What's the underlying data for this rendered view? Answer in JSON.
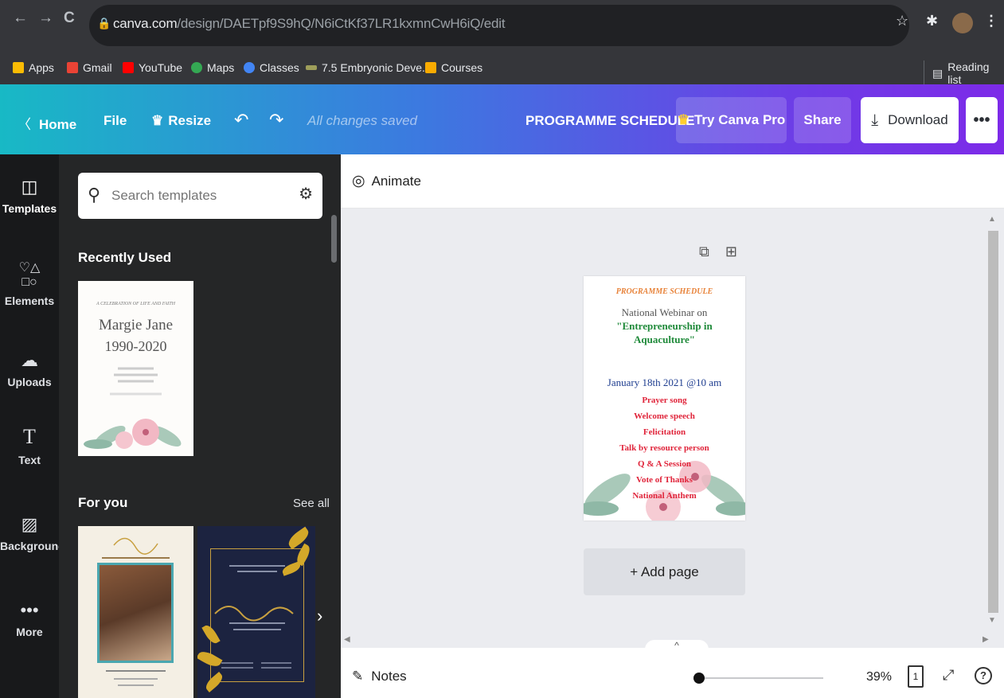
{
  "browser": {
    "url_host": "canva.com",
    "url_path": "/design/DAETpf9S9hQ/N6iCtKf37LR1kxmnCwH6iQ/edit",
    "bookmarks": [
      {
        "label": "Apps",
        "color": "#fbbc04"
      },
      {
        "label": "Gmail",
        "color": "#ea4335"
      },
      {
        "label": "YouTube",
        "color": "#ff0000"
      },
      {
        "label": "Maps",
        "color": "#34a853"
      },
      {
        "label": "Classes",
        "color": "#4285f4"
      },
      {
        "label": "7.5 Embryonic Deve...",
        "color": "#9e9e5a"
      },
      {
        "label": "Courses",
        "color": "#f9ab00"
      }
    ],
    "reading_list": "Reading list"
  },
  "header": {
    "home": "Home",
    "file": "File",
    "resize": "Resize",
    "saved_status": "All changes saved",
    "design_title": "PROGRAMME SCHEDULE",
    "try_pro": "Try Canva Pro",
    "share": "Share",
    "download": "Download",
    "more": "•••"
  },
  "rail": [
    {
      "label": "Templates",
      "icon": "templates-icon"
    },
    {
      "label": "Elements",
      "icon": "elements-icon"
    },
    {
      "label": "Uploads",
      "icon": "uploads-icon"
    },
    {
      "label": "Text",
      "icon": "text-icon"
    },
    {
      "label": "Background",
      "icon": "background-icon"
    },
    {
      "label": "More",
      "icon": "more-icon"
    }
  ],
  "panel": {
    "search_placeholder": "Search templates",
    "recently_used": "Recently Used",
    "for_you": "For you",
    "see_all": "See all",
    "recent_template": {
      "line1": "A CELEBRATION OF LIFE AND FAITH",
      "name": "Margie Jane",
      "years": "1990-2020"
    }
  },
  "toolbar": {
    "animate": "Animate"
  },
  "design": {
    "heading": "PROGRAMME SCHEDULE",
    "line1": "National Webinar on",
    "line2": "\"Entrepreneurship in",
    "line3": "Aquaculture\"",
    "date": "January 18th 2021 @10 am",
    "items": [
      "Prayer song",
      "Welcome speech",
      "Felicitation",
      "Talk by resource person",
      "Q & A Session",
      "Vote of Thanks",
      "National Anthem"
    ]
  },
  "canvas": {
    "add_page": "+ Add page"
  },
  "footer": {
    "notes": "Notes",
    "zoom": "39%",
    "page_count": "1",
    "help": "?"
  }
}
